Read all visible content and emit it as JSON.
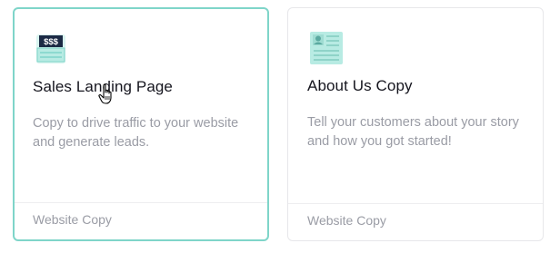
{
  "cards": [
    {
      "icon": "sales-money-icon",
      "icon_text": "$$$",
      "title": "Sales Landing Page",
      "description": "Copy to drive traffic to your website and generate leads.",
      "category": "Website Copy",
      "selected": true
    },
    {
      "icon": "about-profile-icon",
      "title": "About Us Copy",
      "description": "Tell your customers about your story and how you got started!",
      "category": "Website Copy",
      "selected": false
    }
  ],
  "colors": {
    "accent": "#7fd5c9",
    "icon_fill": "#b8ebe3",
    "title": "#15151e",
    "muted": "#9a9ca5",
    "border": "#e7e7ea"
  },
  "cursor": "hand-pointer-icon"
}
